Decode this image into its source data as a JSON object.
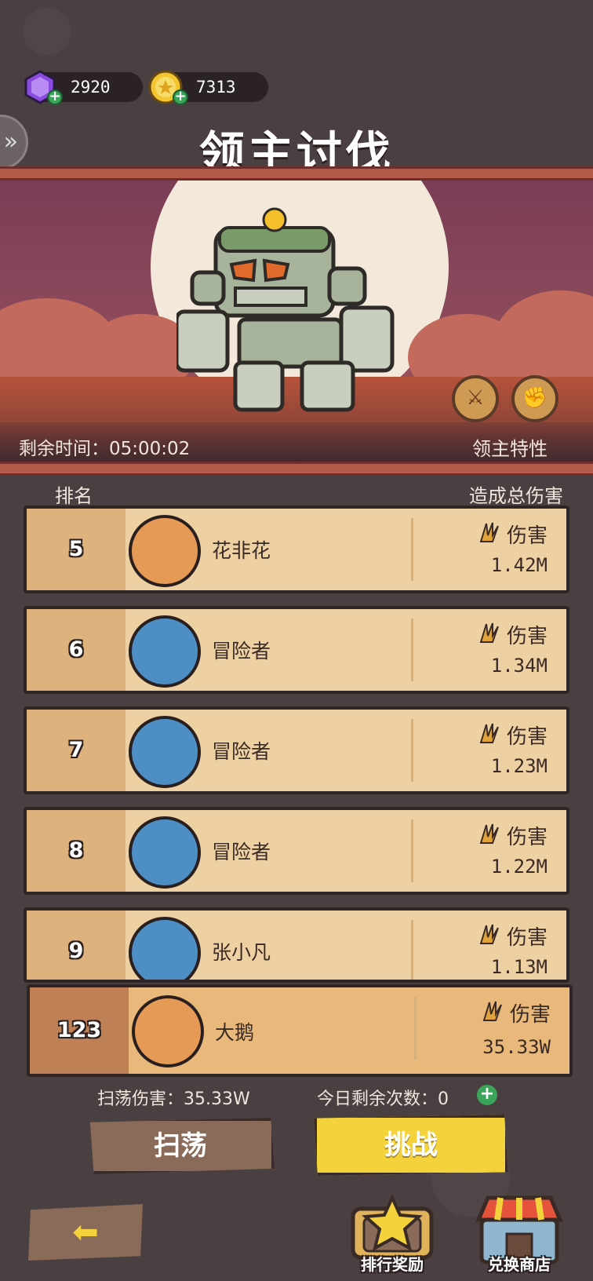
{
  "currency": {
    "gems": "2920",
    "coins": "7313"
  },
  "page": {
    "title": "领主讨伐"
  },
  "boss": {
    "timer_label": "剩余时间：05:00:02",
    "traits_label": "领主特性"
  },
  "table": {
    "col_rank": "排名",
    "col_damage": "造成总伤害",
    "damage_label": "伤害",
    "rows": [
      {
        "rank": "5",
        "name": "花非花",
        "damage": "1.42M"
      },
      {
        "rank": "6",
        "name": "冒险者",
        "damage": "1.34M"
      },
      {
        "rank": "7",
        "name": "冒险者",
        "damage": "1.23M"
      },
      {
        "rank": "8",
        "name": "冒险者",
        "damage": "1.22M"
      },
      {
        "rank": "9",
        "name": "张小凡",
        "damage": "1.13M"
      }
    ],
    "mine": {
      "rank": "123",
      "name": "大鹅",
      "damage": "35.33W"
    }
  },
  "summary": {
    "sweep_damage": "扫荡伤害：35.33W",
    "remaining": "今日剩余次数：0"
  },
  "buttons": {
    "sweep": "扫荡",
    "challenge": "挑战",
    "rank_rewards": "排行奖励",
    "shop": "兑换商店"
  },
  "colors": {
    "background": "#4a3f41",
    "row_bg": "#eed1a3",
    "challenge_yellow": "#f3d23b"
  }
}
